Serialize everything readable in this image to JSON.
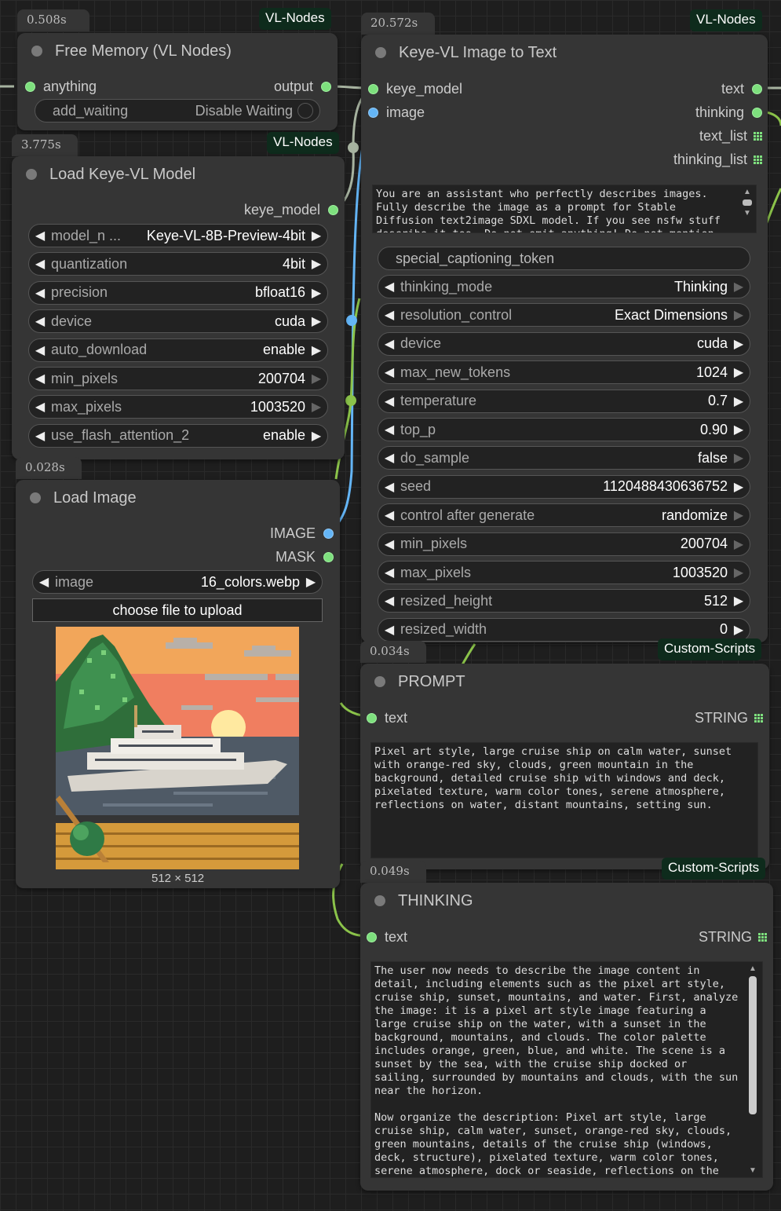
{
  "nodes": {
    "free_memory": {
      "timing": "0.508s",
      "badge": "VL-Nodes",
      "title": "Free Memory (VL Nodes)",
      "input": "anything",
      "output": "output",
      "widget_label": "add_waiting",
      "widget_value": "Disable Waiting"
    },
    "load_keye": {
      "timing": "3.775s",
      "badge": "VL-Nodes",
      "title": "Load Keye-VL Model",
      "output": "keye_model",
      "widgets": [
        {
          "label": "model_n ...",
          "value": "Keye-VL-8B-Preview-4bit"
        },
        {
          "label": "quantization",
          "value": "4bit"
        },
        {
          "label": "precision",
          "value": "bfloat16"
        },
        {
          "label": "device",
          "value": "cuda"
        },
        {
          "label": "auto_download",
          "value": "enable"
        },
        {
          "label": "min_pixels",
          "value": "200704"
        },
        {
          "label": "max_pixels",
          "value": "1003520"
        },
        {
          "label": "use_flash_attention_2",
          "value": "enable"
        }
      ]
    },
    "load_image": {
      "timing": "0.028s",
      "title": "Load Image",
      "outputs": [
        "IMAGE",
        "MASK"
      ],
      "widget_label": "image",
      "widget_value": "16_colors.webp",
      "upload_label": "choose file to upload",
      "dimensions": "512 × 512"
    },
    "image_to_text": {
      "timing": "20.572s",
      "badge": "VL-Nodes",
      "title": "Keye-VL Image to Text",
      "inputs": [
        "keye_model",
        "image"
      ],
      "outputs": [
        "text",
        "thinking",
        "text_list",
        "thinking_list"
      ],
      "prompt": "You are an assistant who perfectly describes images. Fully describe the image as a prompt for Stable Diffusion text2image SDXL model. If you see nsfw stuff describe it too. Do not omit anything! Do not mention",
      "special_token": "special_captioning_token",
      "widgets": [
        {
          "label": "thinking_mode",
          "value": "Thinking"
        },
        {
          "label": "resolution_control",
          "value": "Exact Dimensions"
        },
        {
          "label": "device",
          "value": "cuda"
        },
        {
          "label": "max_new_tokens",
          "value": "1024"
        },
        {
          "label": "temperature",
          "value": "0.7"
        },
        {
          "label": "top_p",
          "value": "0.90"
        },
        {
          "label": "do_sample",
          "value": "false"
        },
        {
          "label": "seed",
          "value": "1120488430636752"
        },
        {
          "label": "control after generate",
          "value": "randomize"
        },
        {
          "label": "min_pixels",
          "value": "200704"
        },
        {
          "label": "max_pixels",
          "value": "1003520"
        },
        {
          "label": "resized_height",
          "value": "512"
        },
        {
          "label": "resized_width",
          "value": "0"
        }
      ]
    },
    "prompt_node": {
      "timing": "0.034s",
      "badge": "Custom-Scripts",
      "title": "PROMPT",
      "input": "text",
      "output": "STRING",
      "text": "Pixel art style, large cruise ship on calm water, sunset with orange-red sky, clouds, green mountain in the background, detailed cruise ship with windows and deck, pixelated texture, warm color tones, serene atmosphere, reflections on water, distant mountains, setting sun."
    },
    "thinking_node": {
      "timing": "0.049s",
      "badge": "Custom-Scripts",
      "title": "THINKING",
      "input": "text",
      "output": "STRING",
      "text": "The user now needs to describe the image content in detail, including elements such as the pixel art style, cruise ship, sunset, mountains, and water. First, analyze the image: it is a pixel art style image featuring a large cruise ship on the water, with a sunset in the background, mountains, and clouds. The color palette includes orange, green, blue, and white. The scene is a sunset by the sea, with the cruise ship docked or sailing, surrounded by mountains and clouds, with the sun near the horizon.\n\nNow organize the description: Pixel art style, large cruise ship, calm water, sunset, orange-red sky, clouds, green mountains, details of the cruise ship (windows, deck, structure), pixelated texture, warm color tones, serene atmosphere, dock or seaside, reflections on the"
    }
  },
  "colors": {
    "wire_green": "#8bc34a",
    "wire_blue": "#64b5f6",
    "wire_gray": "#a7b3a0",
    "badge_bg": "#0e2b1c"
  }
}
